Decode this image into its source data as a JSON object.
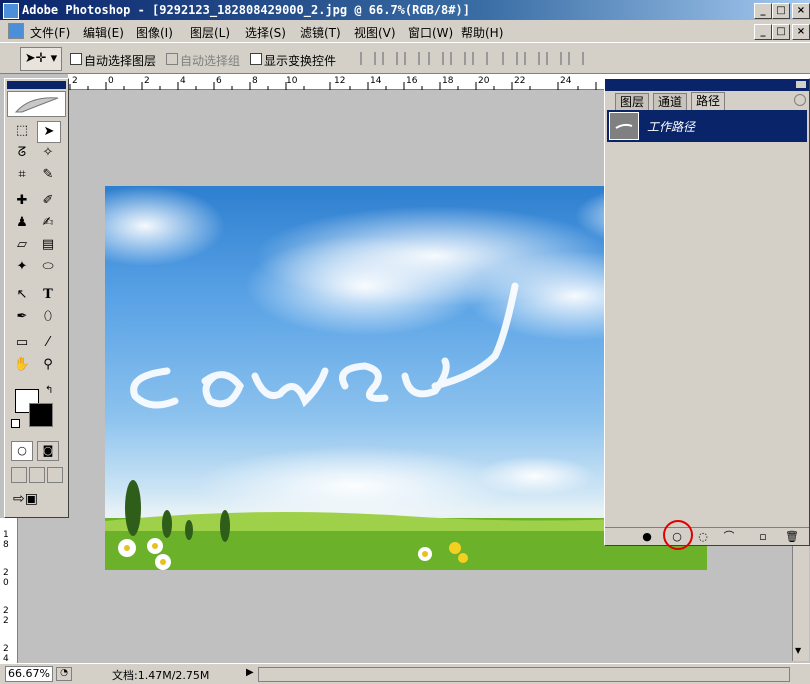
{
  "window": {
    "title": "Adobe Photoshop - [9292123_182808429000_2.jpg @ 66.7%(RGB/8#)]",
    "buttons": [
      "_",
      "□",
      "×"
    ]
  },
  "menu": [
    "文件(F)",
    "编辑(E)",
    "图像(I)",
    "图层(L)",
    "选择(S)",
    "滤镜(T)",
    "视图(V)",
    "窗口(W)",
    "帮助(H)"
  ],
  "options": {
    "auto_select_layer": "自动选择图层",
    "auto_select_group": "自动选择组",
    "show_transform": "显示变换控件"
  },
  "ruler": {
    "h_labels": [
      "2",
      "0",
      "2",
      "4",
      "6",
      "8",
      "10",
      "12",
      "14",
      "16",
      "18",
      "20",
      "22",
      "24"
    ],
    "v_labels": [
      "1",
      "8",
      "2",
      "0",
      "2",
      "2",
      "2",
      "4"
    ]
  },
  "panel": {
    "tabs": [
      "图层",
      "通道",
      "路径"
    ],
    "active_tab": "路径",
    "path_item": "工作路径"
  },
  "status": {
    "zoom": "66.67%",
    "doc_info": "文档:1.47M/2.75M"
  },
  "colors": {
    "titlebar": "#0a246a",
    "selection": "#0a246a",
    "chrome": "#d4d0c8",
    "highlight_circle": "#e00000"
  }
}
